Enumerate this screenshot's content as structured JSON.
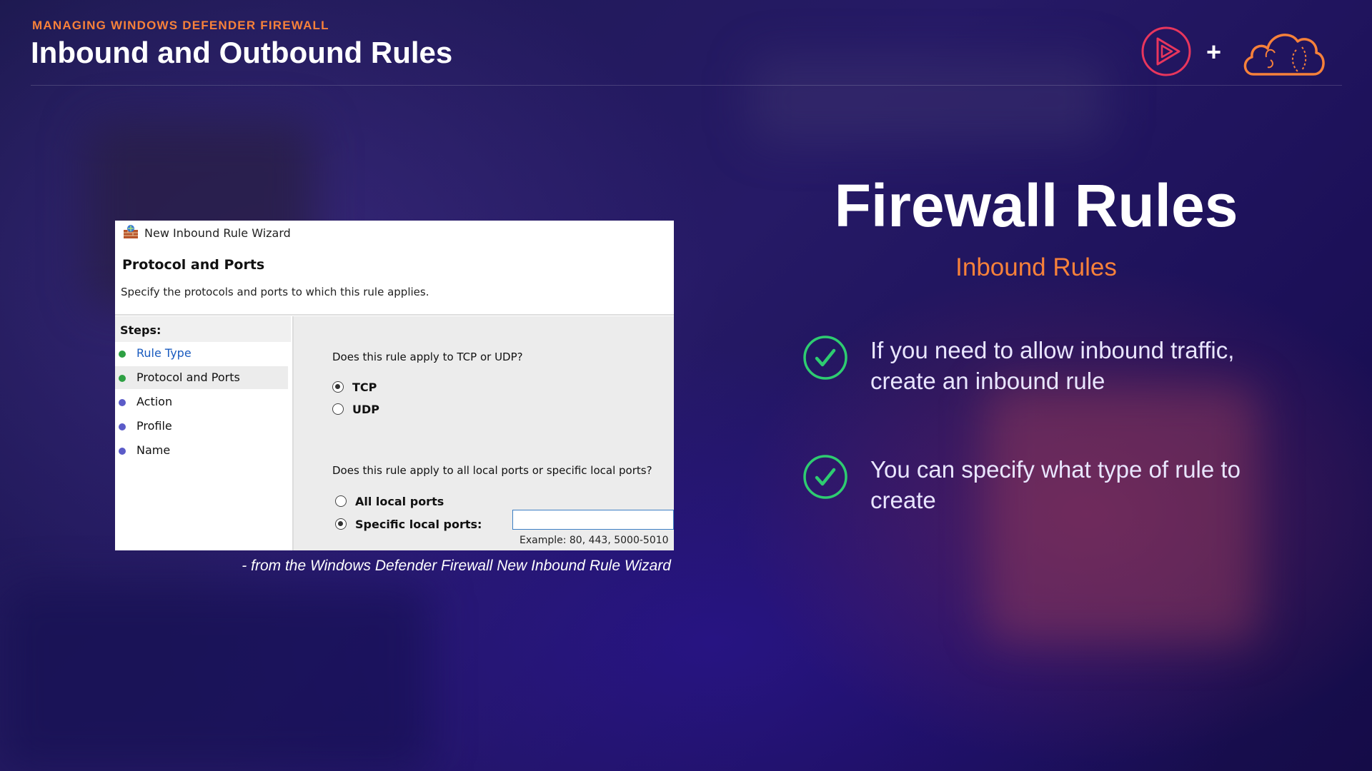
{
  "header": {
    "kicker": "MANAGING WINDOWS DEFENDER FIREWALL",
    "title": "Inbound and Outbound Rules"
  },
  "logos": {
    "plus": "+",
    "icons": [
      "pluralsight-play-icon",
      "cloud-logo-icon"
    ]
  },
  "colors": {
    "accent_orange": "#f7813a",
    "check_green": "#2ecc71",
    "brand_pink": "#e8365d"
  },
  "wizard": {
    "window_title": "New Inbound Rule Wizard",
    "heading": "Protocol and Ports",
    "subheading": "Specify the protocols and ports to which this rule applies.",
    "steps_label": "Steps:",
    "steps": [
      {
        "label": "Rule Type",
        "status": "done",
        "color": "#2ea043"
      },
      {
        "label": "Protocol and Ports",
        "status": "current",
        "color": "#2ea043"
      },
      {
        "label": "Action",
        "status": "pending",
        "color": "#5b5bc8"
      },
      {
        "label": "Profile",
        "status": "pending",
        "color": "#5b5bc8"
      },
      {
        "label": "Name",
        "status": "pending",
        "color": "#5b5bc8"
      }
    ],
    "question_protocol": "Does this rule apply to TCP or UDP?",
    "protocol_options": [
      {
        "label": "TCP",
        "checked": true
      },
      {
        "label": "UDP",
        "checked": false
      }
    ],
    "question_ports": "Does this rule apply to all local ports or specific local ports?",
    "port_options": [
      {
        "label": "All local ports",
        "checked": false
      },
      {
        "label": "Specific local ports:",
        "checked": true
      }
    ],
    "ports_value": "",
    "ports_example": "Example: 80, 443, 5000-5010"
  },
  "caption": "- from the Windows Defender Firewall New Inbound Rule Wizard",
  "main": {
    "title": "Firewall Rules",
    "subtitle": "Inbound Rules",
    "bullets": [
      "If you need to allow inbound traffic, create an inbound rule",
      "You can specify what type of rule to create"
    ]
  }
}
